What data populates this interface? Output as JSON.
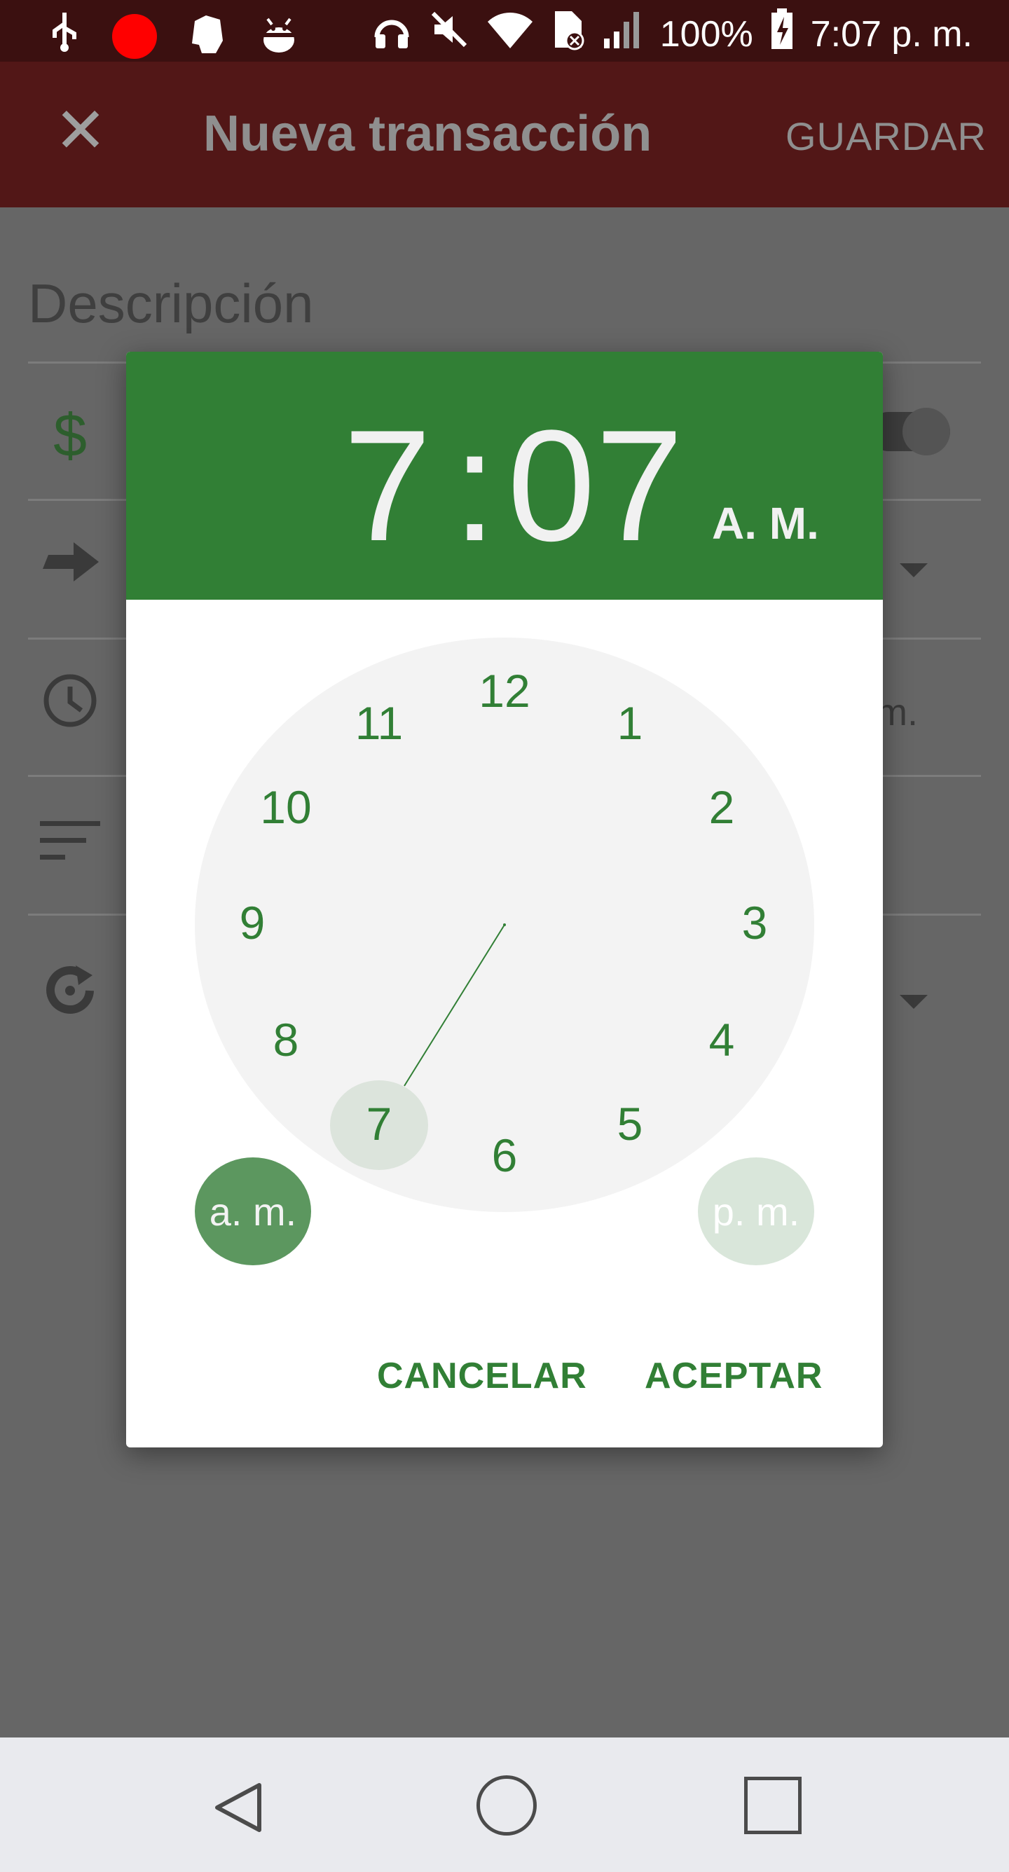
{
  "status_bar": {
    "battery": "100%",
    "time": "7:07 p. m.",
    "icons": [
      "usb-icon",
      "record-icon",
      "evernote-icon",
      "android-debug-icon",
      "headphones-icon",
      "mute-icon",
      "wifi-icon",
      "sim-error-icon",
      "signal-icon",
      "battery-charging-icon"
    ]
  },
  "app_bar": {
    "title": "Nueva transacción",
    "save_label": "GUARDAR",
    "close_icon": "close-icon"
  },
  "form": {
    "description_placeholder": "Descripción",
    "amount_icon": "$",
    "time_partial": "m."
  },
  "dialog": {
    "hour": "7",
    "separator": ":",
    "minute": "07",
    "period": "A. M.",
    "clock_numbers": [
      "12",
      "1",
      "2",
      "3",
      "4",
      "5",
      "6",
      "7",
      "8",
      "9",
      "10",
      "11"
    ],
    "selected_hour": "7",
    "am_label": "a. m.",
    "pm_label": "p. m.",
    "cancel_label": "CANCELAR",
    "accept_label": "ACEPTAR"
  },
  "colors": {
    "header_green": "#317f35",
    "appbar": "#521717",
    "accent_text": "#317f35"
  }
}
